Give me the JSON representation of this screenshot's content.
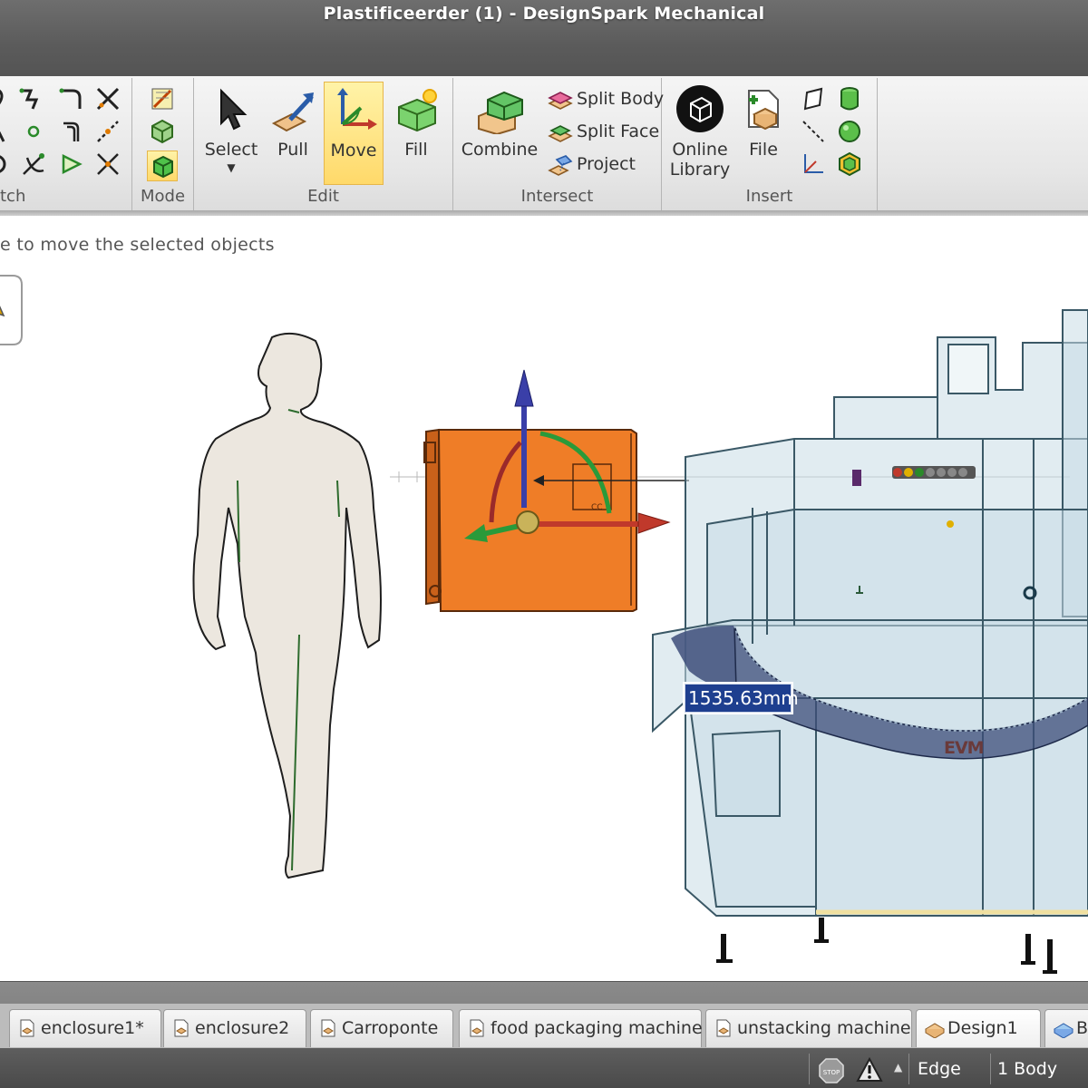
{
  "window": {
    "title": "Plastificeerder (1) - DesignSpark Mechanical"
  },
  "ribbon": {
    "groups": {
      "sketch": {
        "label": "tch"
      },
      "mode": {
        "label": "Mode"
      },
      "edit": {
        "label": "Edit",
        "tools": [
          "Select",
          "Pull",
          "Move",
          "Fill"
        ],
        "active_tool": "Move"
      },
      "intersect": {
        "label": "Intersect",
        "big": "Combine",
        "small": [
          "Split Body",
          "Split Face",
          "Project"
        ]
      },
      "insert": {
        "label": "Insert",
        "online_library": [
          "Online",
          "Library"
        ],
        "file": "File"
      }
    }
  },
  "hint": "e to move the selected objects",
  "viewport": {
    "dimension_value": "1535.63mm",
    "machine_label": "EVM",
    "axis_marker": "x",
    "colors": {
      "box": "#ef7d27",
      "machine": "#c8dde6",
      "human": "#ece7df"
    }
  },
  "tabs": [
    "enclosure1*",
    "enclosure2",
    "Carroponte",
    "food packaging machine",
    "unstacking machine",
    "Design1",
    "B"
  ],
  "status": {
    "select_filter": "Edge",
    "selection": "1 Body",
    "icons": [
      "stop-icon",
      "warning-icon",
      "up-arrow-icon"
    ]
  }
}
